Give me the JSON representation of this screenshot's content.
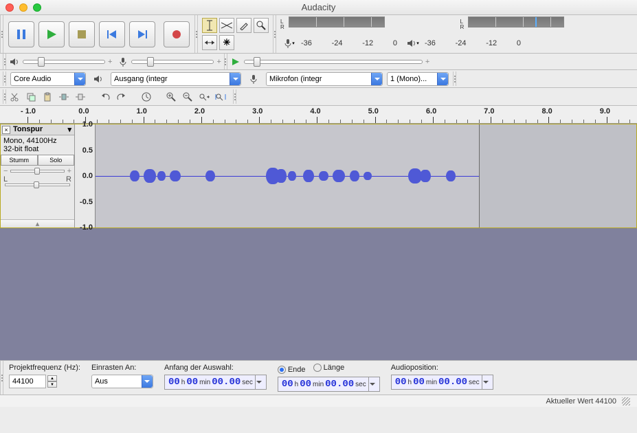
{
  "titlebar": {
    "title": "Audacity"
  },
  "meter_ticks": [
    "-36",
    "-24",
    "-12",
    "0"
  ],
  "device_row": {
    "host": "Core Audio",
    "output": "Ausgang (integr",
    "input": "Mikrofon (integr",
    "channels": "1 (Mono)..."
  },
  "ruler": {
    "labels": [
      "- 1.0",
      "0.0",
      "1.0",
      "2.0",
      "3.0",
      "4.0",
      "5.0",
      "6.0",
      "7.0",
      "8.0",
      "9.0"
    ]
  },
  "track": {
    "menu": "Tonspur",
    "info1": "Mono, 44100Hz",
    "info2": "32-bit float",
    "mute": "Stumm",
    "solo": "Solo",
    "L": "L",
    "R": "R",
    "vscale": [
      "1.0",
      "0.5",
      "0.0",
      "-0.5",
      "-1.0"
    ]
  },
  "bottom": {
    "rate_label": "Projektfrequenz (Hz):",
    "rate_value": "44100",
    "snap_label": "Einrasten An:",
    "snap_value": "Aus",
    "sel_label": "Anfang der Auswahl:",
    "end_label": "Ende",
    "len_label": "Länge",
    "pos_label": "Audioposition:",
    "t_h": "00",
    "t_hU": "h",
    "t_m": "00",
    "t_mU": "min",
    "t_s": "00.00",
    "t_sU": "sec"
  },
  "status": {
    "text": "Aktueller Wert 44100"
  },
  "meter_lr": {
    "L": "L",
    "R": "R"
  }
}
